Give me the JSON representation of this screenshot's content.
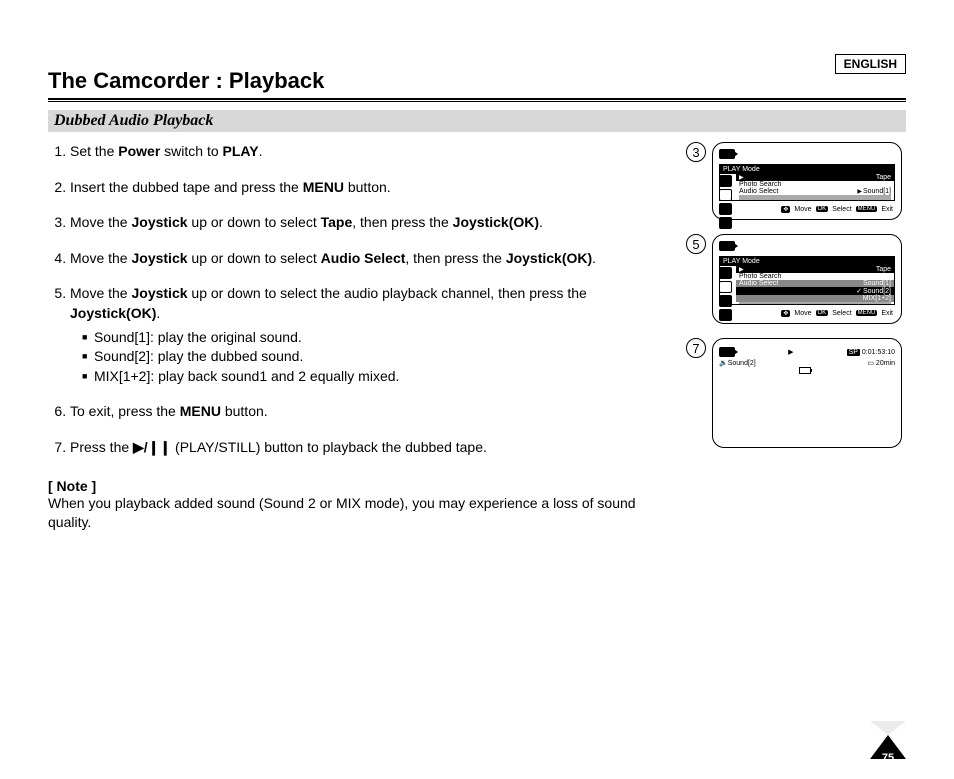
{
  "header": {
    "language": "ENGLISH",
    "title": "The Camcorder : Playback",
    "subheading": "Dubbed Audio Playback"
  },
  "steps": {
    "s1_a": "Set the ",
    "s1_b": "Power",
    "s1_c": " switch to ",
    "s1_d": "PLAY",
    "s1_e": ".",
    "s2_a": "Insert the dubbed tape and press the ",
    "s2_b": "MENU",
    "s2_c": " button.",
    "s3_a": "Move the ",
    "s3_b": "Joystick",
    "s3_c": " up or down to select ",
    "s3_d": "Tape",
    "s3_e": ", then press the ",
    "s3_f": "Joystick(OK)",
    "s3_g": ".",
    "s4_a": "Move the ",
    "s4_b": "Joystick",
    "s4_c": " up or down to select ",
    "s4_d": "Audio Select",
    "s4_e": ", then press the ",
    "s4_f": "Joystick(OK)",
    "s4_g": ".",
    "s5_a": "Move the ",
    "s5_b": "Joystick",
    "s5_c": " up or down to select the audio playback channel, then press the ",
    "s5_d": "Joystick(OK)",
    "s5_e": ".",
    "s5_opt1": "Sound[1]: play the original sound.",
    "s5_opt2": "Sound[2]: play the dubbed sound.",
    "s5_opt3": "MIX[1+2]: play back sound1 and 2 equally mixed.",
    "s6_a": "To exit, press the ",
    "s6_b": "MENU",
    "s6_c": " button.",
    "s7_a": "Press the ",
    "s7_b": "▶/❙❙",
    "s7_c": " (PLAY/STILL) button to playback the dubbed tape."
  },
  "note": {
    "label": "[ Note ]",
    "text": "When you playback added sound (Sound 2 or MIX mode), you may experience a loss of sound quality."
  },
  "figures": {
    "f3": {
      "num": "3",
      "header": "PLAY Mode",
      "item_tape": "Tape",
      "item_photo": "Photo Search",
      "item_audio": "Audio Select",
      "value": "Sound[1]",
      "move": "Move",
      "select": "Select",
      "exit": "Exit",
      "ok": "OK",
      "menu": "MENU"
    },
    "f5": {
      "num": "5",
      "header": "PLAY Mode",
      "item_tape": "Tape",
      "item_photo": "Photo Search",
      "item_audio": "Audio Select",
      "opt1": "Sound[1]",
      "opt2": "Sound[2]",
      "opt3": "MIX[1+2]",
      "move": "Move",
      "select": "Select",
      "exit": "Exit",
      "ok": "OK",
      "menu": "MENU"
    },
    "f7": {
      "num": "7",
      "sp": "SP",
      "time": "0:01:53:10",
      "remain": "20min",
      "sound": "Sound[2]"
    }
  },
  "page_number": "75"
}
